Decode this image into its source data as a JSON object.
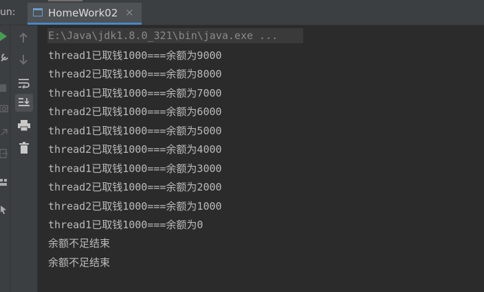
{
  "run_label": "un:",
  "tab": {
    "title": "HomeWork02",
    "close": "×"
  },
  "toolbar_icons": [
    "up-arrow-icon",
    "down-arrow-icon",
    "soft-wrap-icon",
    "scroll-to-end-icon",
    "print-icon",
    "trash-icon"
  ],
  "left_icons": [
    "run-icon",
    "wrench-icon",
    "stop-icon",
    "camera-icon",
    "arrow-icon",
    "exit-icon",
    "layout-icon",
    "pin-icon"
  ],
  "console": {
    "command": "E:\\Java\\jdk1.8.0_321\\bin\\java.exe ...",
    "lines": [
      "thread1已取钱1000===余额为9000",
      "thread2已取钱1000===余额为8000",
      "thread1已取钱1000===余额为7000",
      "thread2已取钱1000===余额为6000",
      "thread1已取钱1000===余额为5000",
      "thread2已取钱1000===余额为4000",
      "thread1已取钱1000===余额为3000",
      "thread2已取钱1000===余额为2000",
      "thread2已取钱1000===余额为1000",
      "thread1已取钱1000===余额为0",
      "余额不足结束",
      "余额不足结束"
    ]
  },
  "colors": {
    "accent": "#4a88c7",
    "run_green": "#499c54",
    "text": "#bbbbbb"
  }
}
